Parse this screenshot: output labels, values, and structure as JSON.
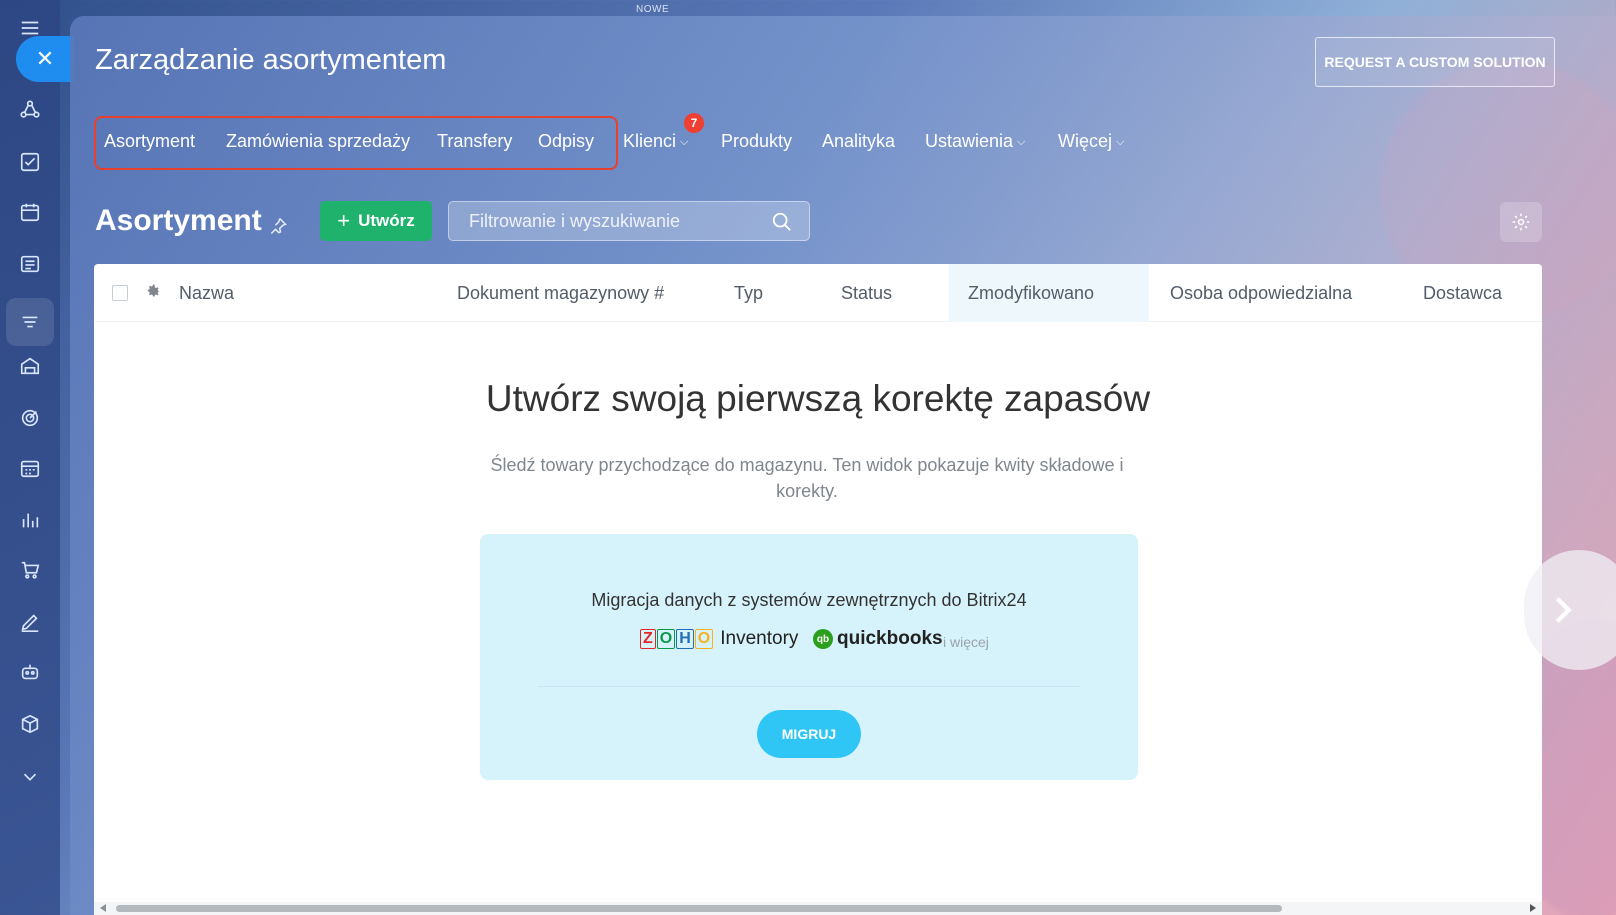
{
  "top_notice": "NOWE",
  "panel": {
    "title": "Zarządzanie asortymentem",
    "request_button": "REQUEST A CUSTOM SOLUTION"
  },
  "menu": {
    "items": [
      {
        "label": "Asortyment"
      },
      {
        "label": "Zamówienia sprzedaży"
      },
      {
        "label": "Transfery"
      },
      {
        "label": "Odpisy"
      },
      {
        "label": "Klienci",
        "badge": "7"
      },
      {
        "label": "Produkty"
      },
      {
        "label": "Analityka"
      },
      {
        "label": "Ustawienia"
      },
      {
        "label": "Więcej"
      }
    ]
  },
  "toolbar": {
    "page_title": "Asortyment",
    "create_label": "Utwórz",
    "search_placeholder": "Filtrowanie i wyszukiwanie"
  },
  "grid": {
    "columns": [
      "Nazwa",
      "Dokument magazynowy #",
      "Typ",
      "Status",
      "Zmodyfikowano",
      "Osoba odpowiedzialna",
      "Dostawca"
    ]
  },
  "empty_state": {
    "title": "Utwórz swoją pierwszą korektę zapasów",
    "description": "Śledź towary przychodzące do magazynu. Ten widok pokazuje kwity składowe i korekty."
  },
  "migration": {
    "title": "Migracja danych z systemów zewnętrznych do Bitrix24",
    "zoho_letters": [
      "Z",
      "O",
      "H",
      "O"
    ],
    "zoho_word": "Inventory",
    "qb_mark": "qb",
    "qb_word": "quickbooks",
    "more": "i więcej",
    "button": "MIGRUJ"
  },
  "colors": {
    "accent_blue": "#1f8df0",
    "create_green": "#1fb26d",
    "migrate_cyan": "#2fc6f6",
    "highlight_red": "#e8402c",
    "badge_red": "#ef3f33"
  }
}
